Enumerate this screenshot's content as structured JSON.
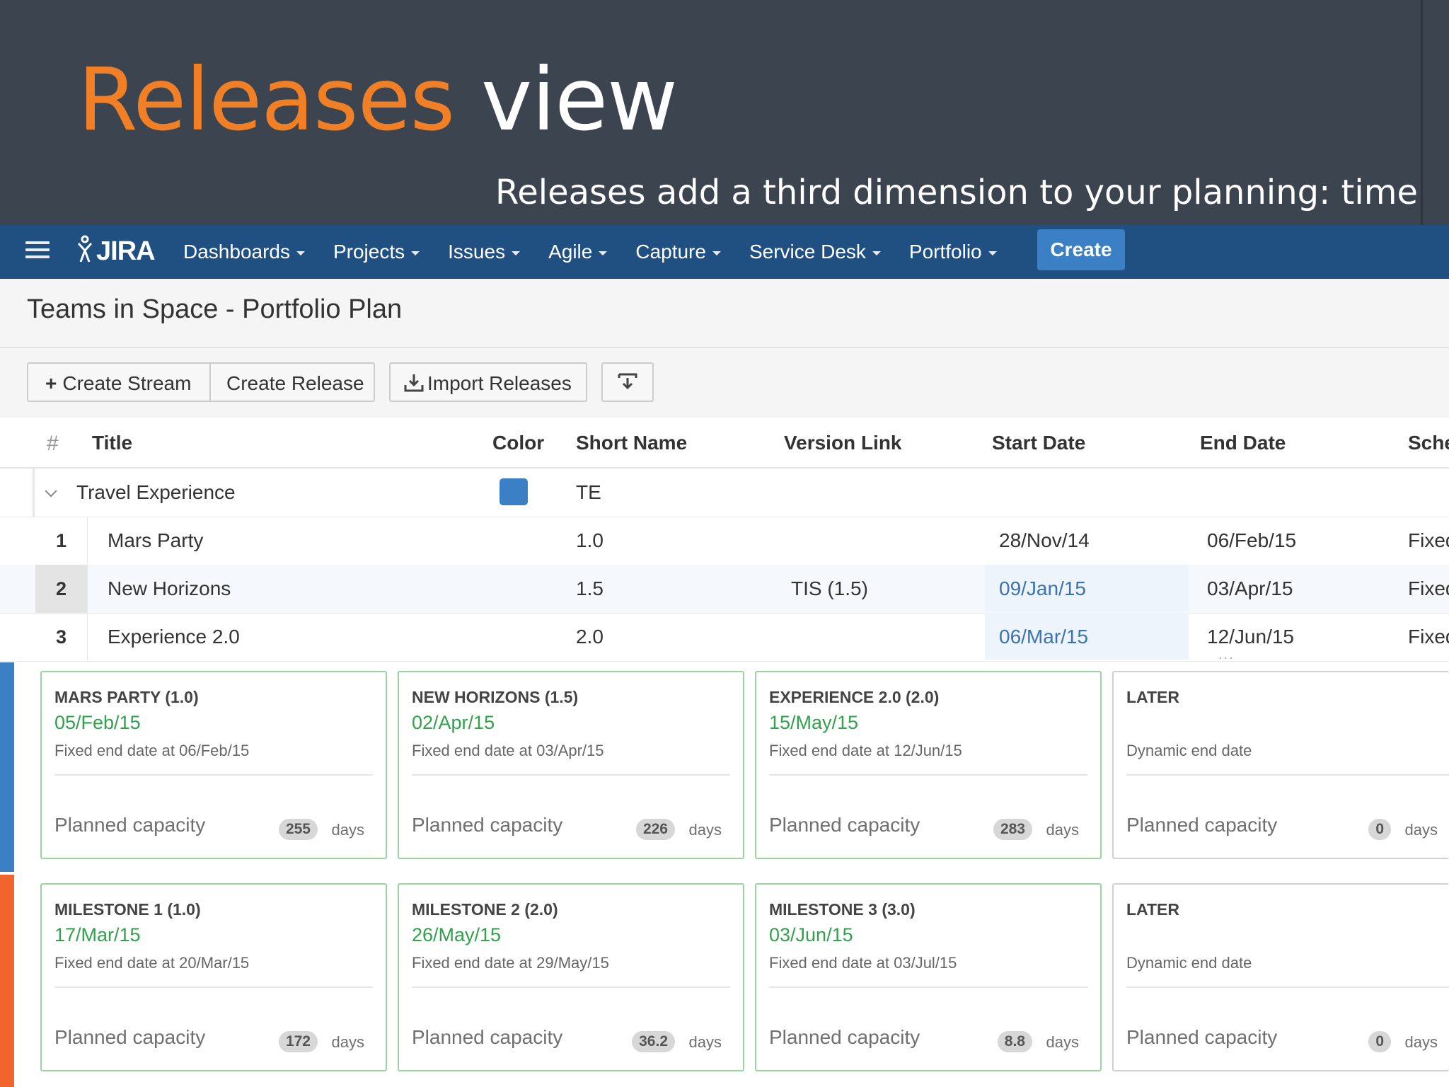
{
  "slide": {
    "title_accent": "Releases",
    "title_rest": "view",
    "subtitle": "Releases add a third dimension to your planning: time",
    "accent_color": "#f07f26",
    "background_color": "#3b444f"
  },
  "nav": {
    "logo": "JIRA",
    "items": [
      "Dashboards",
      "Projects",
      "Issues",
      "Agile",
      "Capture",
      "Service Desk",
      "Portfolio"
    ],
    "create_label": "Create"
  },
  "plan": {
    "title": "Teams in Space - Portfolio Plan"
  },
  "toolbar": {
    "create_stream": "Create Stream",
    "create_release": "Create Release",
    "import_releases": "Import Releases"
  },
  "table": {
    "headers": {
      "num": "#",
      "title": "Title",
      "color": "Color",
      "short_name": "Short Name",
      "version_link": "Version Link",
      "start_date": "Start Date",
      "end_date": "End Date",
      "schedule": "Sche"
    },
    "group": {
      "title": "Travel Experience",
      "color": "#3b7fc4",
      "short_name": "TE"
    },
    "rows": [
      {
        "num": "1",
        "title": "Mars Party",
        "short_name": "1.0",
        "version_link": "",
        "start_date": "28/Nov/14",
        "end_date": "06/Feb/15",
        "schedule": "Fixed"
      },
      {
        "num": "2",
        "title": "New Horizons",
        "short_name": "1.5",
        "version_link": "TIS (1.5)",
        "start_date": "09/Jan/15",
        "end_date": "03/Apr/15",
        "schedule": "Fixed"
      },
      {
        "num": "3",
        "title": "Experience 2.0",
        "short_name": "2.0",
        "version_link": "",
        "start_date": "06/Mar/15",
        "end_date": "12/Jun/15",
        "schedule": "Fixed"
      }
    ]
  },
  "cards": {
    "planned_label": "Planned capacity",
    "days_label": "days",
    "row1": [
      {
        "name": "MARS PARTY (1.0)",
        "date": "05/Feb/15",
        "fixed": "Fixed end date at 06/Feb/15",
        "capacity": "255"
      },
      {
        "name": "NEW HORIZONS (1.5)",
        "date": "02/Apr/15",
        "fixed": "Fixed end date at 03/Apr/15",
        "capacity": "226"
      },
      {
        "name": "EXPERIENCE 2.0 (2.0)",
        "date": "15/May/15",
        "fixed": "Fixed end date at 12/Jun/15",
        "capacity": "283"
      },
      {
        "name": "LATER",
        "date": "",
        "fixed": "Dynamic end date",
        "capacity": "0"
      }
    ],
    "row2": [
      {
        "name": "MILESTONE 1 (1.0)",
        "date": "17/Mar/15",
        "fixed": "Fixed end date at 20/Mar/15",
        "capacity": "172"
      },
      {
        "name": "MILESTONE 2 (2.0)",
        "date": "26/May/15",
        "fixed": "Fixed end date at 29/May/15",
        "capacity": "36.2"
      },
      {
        "name": "MILESTONE 3 (3.0)",
        "date": "03/Jun/15",
        "fixed": "Fixed end date at 03/Jul/15",
        "capacity": "8.8"
      },
      {
        "name": "LATER",
        "date": "",
        "fixed": "Dynamic end date",
        "capacity": "0"
      }
    ],
    "stream_colors": [
      "#3b7fc4",
      "#f1642e"
    ]
  }
}
